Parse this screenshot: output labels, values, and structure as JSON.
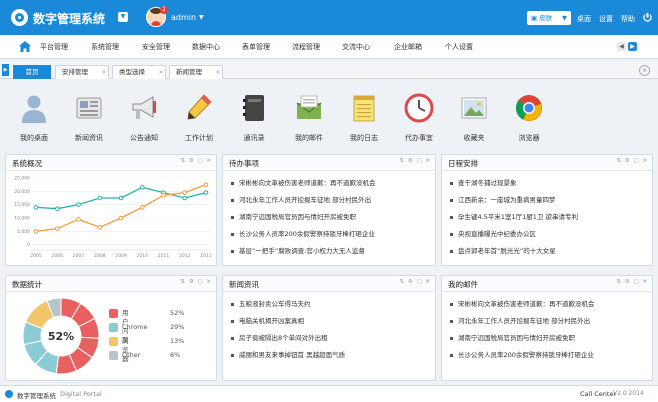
{
  "header": {
    "app_title": "数字管理系统",
    "badge_count": "2",
    "username": "admin",
    "skin_label": "皮肤",
    "links": [
      "桌面",
      "设置",
      "帮助"
    ],
    "brand_color": "#1a8ad8"
  },
  "nav": {
    "items": [
      "平台管理",
      "系统管理",
      "安全管理",
      "数据中心",
      "表单管理",
      "流程管理",
      "交流中心",
      "企业邮箱",
      "个人设置"
    ]
  },
  "tabs": {
    "items": [
      {
        "label": "首页",
        "active": true
      },
      {
        "label": "安排管理",
        "active": false
      },
      {
        "label": "类型选择",
        "active": false
      },
      {
        "label": "新闻管理",
        "active": false
      }
    ]
  },
  "shortcuts": {
    "items": [
      {
        "label": "我的桌面",
        "icon": "user-icon"
      },
      {
        "label": "新闻资讯",
        "icon": "news-icon"
      },
      {
        "label": "公告通知",
        "icon": "megaphone-icon"
      },
      {
        "label": "工作计划",
        "icon": "pencil-icon"
      },
      {
        "label": "通讯录",
        "icon": "address-book-icon"
      },
      {
        "label": "我的邮件",
        "icon": "mail-icon"
      },
      {
        "label": "我的日志",
        "icon": "notepad-icon"
      },
      {
        "label": "代办事宜",
        "icon": "clock-icon"
      },
      {
        "label": "收藏夹",
        "icon": "picture-icon"
      },
      {
        "label": "浏览器",
        "icon": "chrome-icon"
      }
    ]
  },
  "panels": {
    "overview": {
      "title": "系统概况"
    },
    "todo": {
      "title": "待办事项",
      "items": [
        "宋彬彬向文革被伤害老师道歉：再不道歉没机会",
        "河北永年工作人员开挖掘车征地 部分村民外出",
        "湖南宁远国税局官员因与情妇开房被免职",
        "长沙公务人员率200余假警察持锁牙棒打砸企业",
        "基层“一把手”腐败调查:官小权力大无人监督"
      ]
    },
    "schedule": {
      "title": "日程安排",
      "items": [
        "查干湖冬捕过现景象",
        "江西新余：一座城为重病男童四梦",
        "孕生键4.5平米1室1厅1厨1卫 欲串请专利",
        "央视直播曝光中纪委办公区",
        "盘点郭老年首“脱光光”的十大女星"
      ]
    },
    "stats": {
      "title": "数据统计"
    },
    "news": {
      "title": "新闻资讯",
      "items": [
        "五粮液封卖公车得马夫约",
        "电脑关机揭开凶案真相",
        "房子竟被隔出8个单间对外出租",
        "威丽和男友来事掉钮首 黑越超面气质"
      ]
    },
    "mail": {
      "title": "我的邮件",
      "items": [
        "宋彬彬向文革被伤害老师道歉：再不道歉没机会",
        "河北永年工作人员开挖掘车征地 部分村民外出",
        "湖南宁远国税局官员因与情妇开房被免职",
        "长沙公务人员率200余假警察持锁牙棒打砸企业"
      ]
    }
  },
  "line_chart": {
    "type": "line",
    "categories": [
      "2005",
      "2006",
      "2007",
      "2008",
      "2009",
      "2010",
      "2011",
      "2012",
      "2013"
    ],
    "ylim": [
      -2000,
      25000
    ],
    "yticks": [
      "25,000",
      "20,000",
      "15,000",
      "10,000",
      "5,000",
      "0"
    ],
    "series": [
      {
        "color": "#26b5a8",
        "values": [
          14000,
          13500,
          15000,
          17500,
          17500,
          21500,
          19500,
          17500,
          19500
        ]
      },
      {
        "color": "#f29b3b",
        "values": [
          5000,
          6000,
          9500,
          6500,
          10000,
          14000,
          18500,
          19500,
          22500
        ]
      }
    ]
  },
  "donut": {
    "center_label": "52%",
    "segments": [
      {
        "name": "用户问题",
        "value": 52,
        "pct": "52%",
        "color": "#e86060"
      },
      {
        "name": "Chrome",
        "value": 29,
        "pct": "29%",
        "color": "#8ccbd4"
      },
      {
        "name": "浏览器",
        "value": 13,
        "pct": "13%",
        "color": "#f3c46a"
      },
      {
        "name": "Other",
        "value": 6,
        "pct": "6%",
        "color": "#b9c3cc"
      }
    ]
  },
  "footer": {
    "name": "数字管理系统",
    "sub": "Digital Portal",
    "call_center": "Call Center",
    "version": "V2.0 2014"
  }
}
